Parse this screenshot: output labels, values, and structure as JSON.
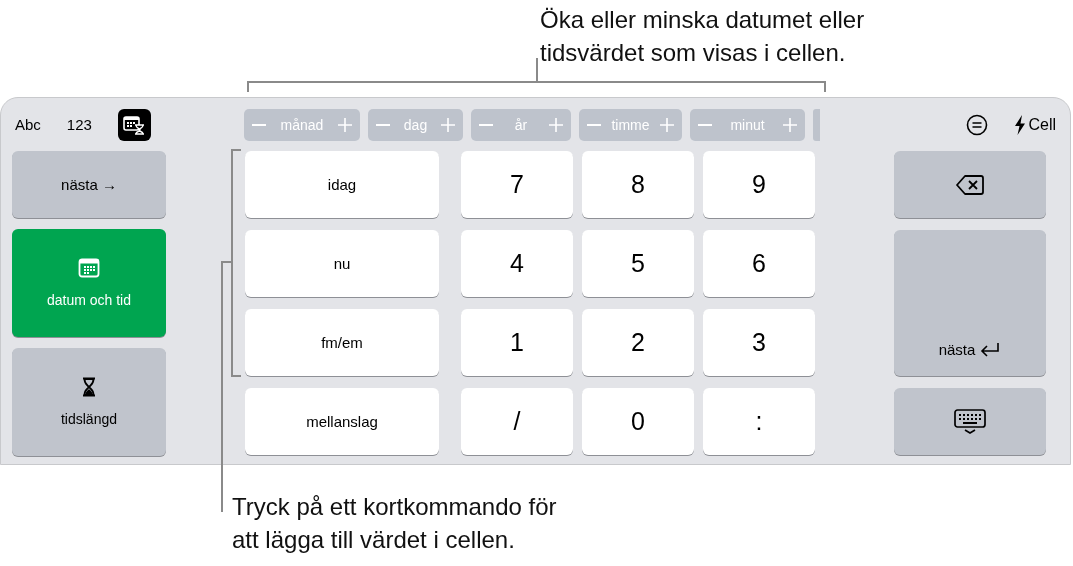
{
  "callouts": [
    {
      "kind": "top",
      "text": "Öka eller minska datumet eller\ntidsvärdet som visas i cellen."
    },
    {
      "kind": "bottom",
      "text": "Tryck på ett kortkommando för\natt lägga till värdet i cellen."
    }
  ],
  "mode_tabs": [
    {
      "kind": "text",
      "label": "Abc",
      "selected": false
    },
    {
      "kind": "text",
      "label": "123",
      "selected": false
    },
    {
      "kind": "datetime",
      "selected": true
    }
  ],
  "steppers": [
    {
      "label": "månad"
    },
    {
      "label": "dag"
    },
    {
      "label": "år"
    },
    {
      "label": "timme"
    },
    {
      "label": "minut"
    }
  ],
  "more_steppers_cut_off": true,
  "cell_button": {
    "label": "Cell"
  },
  "left_keys": [
    {
      "kind": "next",
      "label": "nästa →",
      "selected": false
    },
    {
      "kind": "datetime",
      "label": "datum och tid",
      "selected": true
    },
    {
      "kind": "duration",
      "label": "tidslängd",
      "selected": false
    }
  ],
  "keys": [
    {
      "kind": "shortcut",
      "label": "idag"
    },
    {
      "kind": "digit",
      "label": "7"
    },
    {
      "kind": "digit",
      "label": "8"
    },
    {
      "kind": "digit",
      "label": "9"
    },
    {
      "kind": "shortcut",
      "label": "nu"
    },
    {
      "kind": "digit",
      "label": "4"
    },
    {
      "kind": "digit",
      "label": "5"
    },
    {
      "kind": "digit",
      "label": "6"
    },
    {
      "kind": "shortcut",
      "label": "fm/em"
    },
    {
      "kind": "digit",
      "label": "1"
    },
    {
      "kind": "digit",
      "label": "2"
    },
    {
      "kind": "digit",
      "label": "3"
    },
    {
      "kind": "shortcut",
      "label": "mellanslag"
    },
    {
      "kind": "digit",
      "label": "/"
    },
    {
      "kind": "digit",
      "label": "0"
    },
    {
      "kind": "digit",
      "label": ":"
    }
  ],
  "right_keys": [
    {
      "kind": "delete"
    },
    {
      "kind": "return",
      "label": "nästa"
    },
    {
      "kind": "hide"
    }
  ]
}
